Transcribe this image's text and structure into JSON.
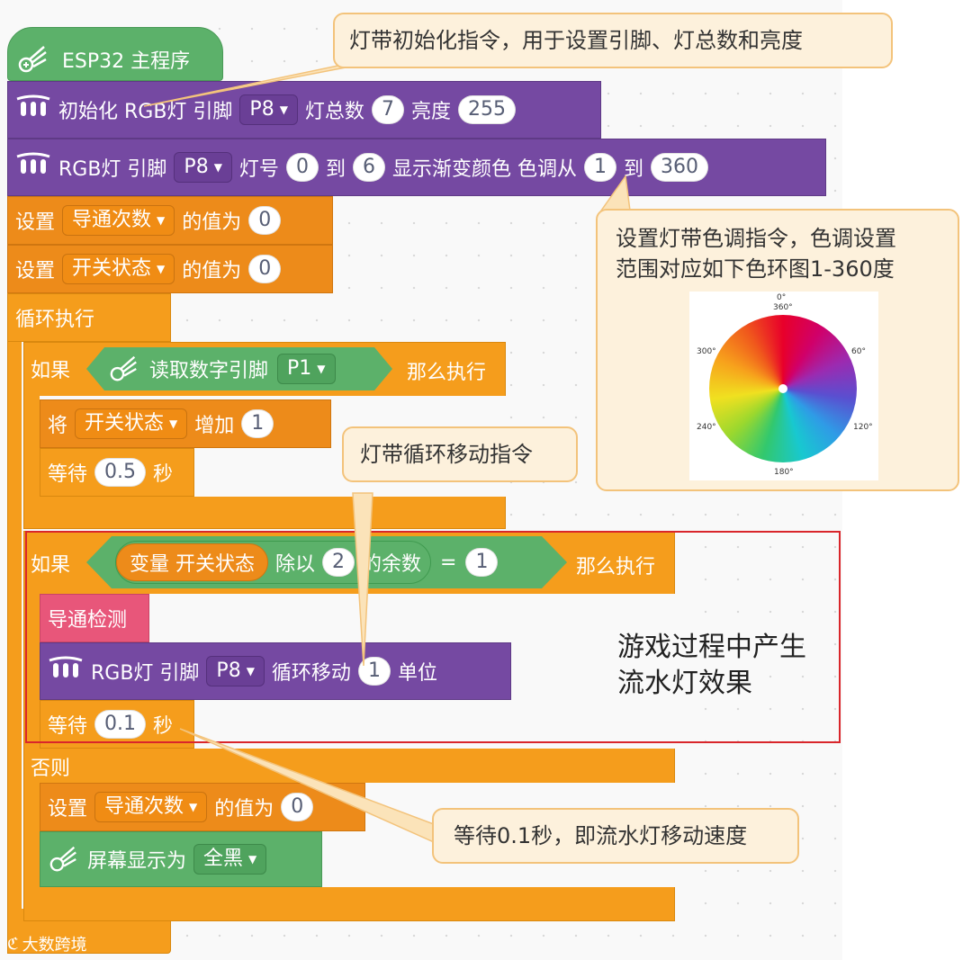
{
  "hat": {
    "label": "ESP32 主程序"
  },
  "init_block": {
    "prefix": "初始化 RGB灯 引脚",
    "pin": "P8",
    "count_label": "灯总数",
    "count": "7",
    "bright_label": "亮度",
    "brightness": "255"
  },
  "gradient_block": {
    "prefix": "RGB灯 引脚",
    "pin": "P8",
    "from_label": "灯号",
    "from": "0",
    "to_label": "到",
    "to": "6",
    "mid_label": "显示渐变颜色 色调从",
    "hue_from": "1",
    "hue_to_label": "到",
    "hue_to": "360"
  },
  "set1": {
    "label": "设置",
    "var": "导通次数",
    "suffix": "的值为",
    "value": "0"
  },
  "set2": {
    "label": "设置",
    "var": "开关状态",
    "suffix": "的值为",
    "value": "0"
  },
  "loop": {
    "label": "循环执行"
  },
  "if1": {
    "label": "如果",
    "read_label": "读取数字引脚",
    "pin": "P1",
    "then_label": "那么执行"
  },
  "change": {
    "label": "将",
    "var": "开关状态",
    "suffix": "增加",
    "value": "1"
  },
  "wait1": {
    "label": "等待",
    "value": "0.5",
    "unit": "秒"
  },
  "if2": {
    "label": "如果",
    "var_label": "变量 开关状态",
    "div_label": "除以",
    "divisor": "2",
    "mod_label": "的余数",
    "eq": "=",
    "rhs": "1",
    "then_label": "那么执行"
  },
  "detect": {
    "label": "导通检测"
  },
  "shift_block": {
    "prefix": "RGB灯 引脚",
    "pin": "P8",
    "mid": "循环移动",
    "value": "1",
    "unit": "单位"
  },
  "wait2": {
    "label": "等待",
    "value": "0.1",
    "unit": "秒"
  },
  "else": {
    "label": "否则"
  },
  "set3": {
    "label": "设置",
    "var": "导通次数",
    "suffix": "的值为",
    "value": "0"
  },
  "screen": {
    "label": "屏幕显示为",
    "option": "全黑"
  },
  "notes": {
    "init": "灯带初始化指令，用于设置引脚、灯总数和亮度",
    "hue_line1": "设置灯带色调指令，色调设置",
    "hue_line2": "范围对应如下色环图1-360度",
    "shift": "灯带循环移动指令",
    "effect_line1": "游戏过程中产生",
    "effect_line2": "流水灯效果",
    "wait": "等待0.1秒，即流水灯移动速度"
  },
  "wheel": {
    "t0": "0°",
    "t360": "360°",
    "t60": "60°",
    "t120": "120°",
    "t180": "180°",
    "t240": "240°",
    "t300": "300°"
  },
  "watermark": "大数跨境",
  "colors": {
    "purple": "#7549a2",
    "orange": "#f59d1c",
    "green": "#5cb16a",
    "pink": "#e8567a",
    "note_bg": "#fdf1dc",
    "note_border": "#f3c37b",
    "highlight": "#d9262b"
  }
}
